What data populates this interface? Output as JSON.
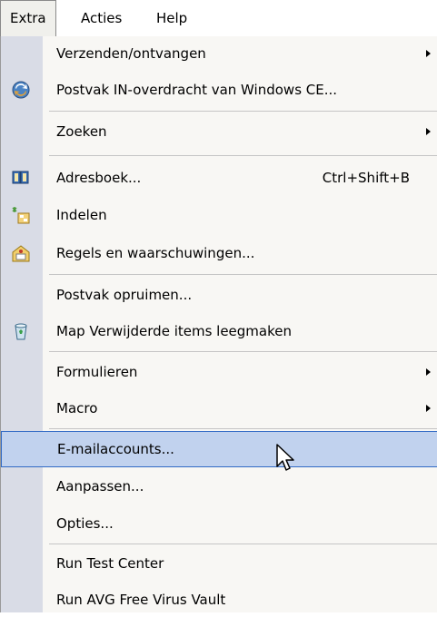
{
  "menubar": {
    "items": [
      {
        "label": "Extra"
      },
      {
        "label": "Acties"
      },
      {
        "label": "Help"
      }
    ]
  },
  "menu": {
    "items": [
      {
        "label": "Verzenden/ontvangen",
        "submenu": true
      },
      {
        "label": "Postvak IN-overdracht van Windows CE...",
        "icon": "sync-icon"
      },
      {
        "label": "Zoeken",
        "submenu": true
      },
      {
        "label": "Adresboek...",
        "shortcut": "Ctrl+Shift+B",
        "icon": "address-book-icon"
      },
      {
        "label": "Indelen",
        "icon": "organize-icon"
      },
      {
        "label": "Regels en waarschuwingen...",
        "icon": "rules-icon"
      },
      {
        "label": "Postvak opruimen..."
      },
      {
        "label": "Map Verwijderde items leegmaken",
        "icon": "recycle-bin-icon"
      },
      {
        "label": "Formulieren",
        "submenu": true
      },
      {
        "label": "Macro",
        "submenu": true
      },
      {
        "label": "E-mailaccounts...",
        "highlighted": true
      },
      {
        "label": "Aanpassen..."
      },
      {
        "label": "Opties..."
      },
      {
        "label": "Run Test Center"
      },
      {
        "label": "Run AVG Free Virus Vault"
      }
    ]
  },
  "colors": {
    "highlight": "#c1d2ee",
    "highlight_border": "#316ac5",
    "gutter": "#d9dce6"
  }
}
